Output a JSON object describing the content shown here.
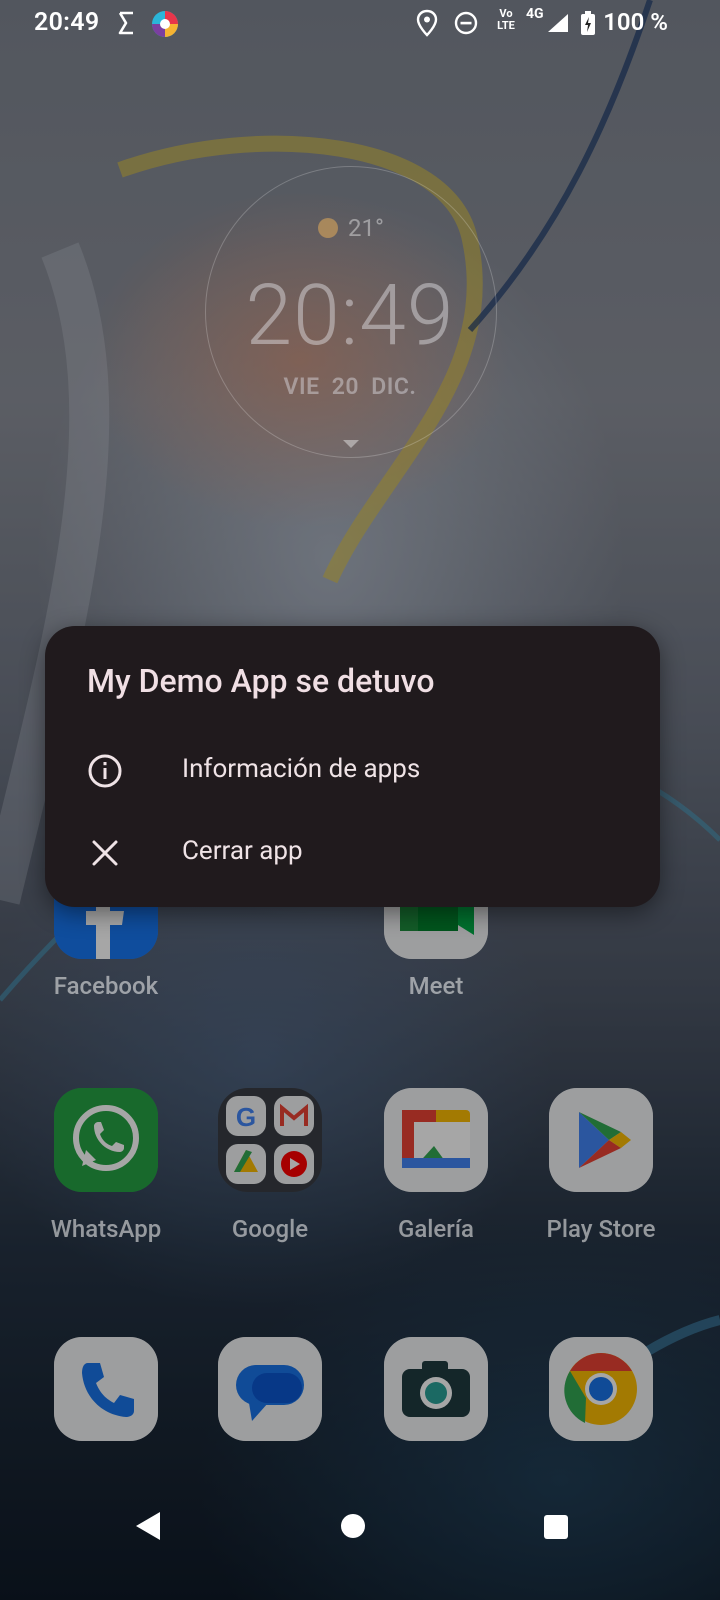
{
  "status_bar": {
    "time": "20:49",
    "network_text_vo": "Vo",
    "network_text_lte": "LTE",
    "network_gen": "4G",
    "battery": "100 %"
  },
  "clock_widget": {
    "temperature": "21°",
    "time": "20:49",
    "date": "VIE  20  DIC."
  },
  "dialog": {
    "title": "My Demo App se detuvo",
    "items": [
      {
        "label": "Información de apps",
        "icon": "info-icon"
      },
      {
        "label": "Cerrar app",
        "icon": "close-icon"
      }
    ]
  },
  "apps": {
    "row1": [
      "Facebook",
      "Meet"
    ],
    "row2": [
      "WhatsApp",
      "Google",
      "Galería",
      "Play Store"
    ]
  },
  "colors": {
    "dialog_bg": "#201a1d",
    "dialog_text": "#efe3e6",
    "whatsapp": "#25a244",
    "facebook": "#1877f2"
  }
}
